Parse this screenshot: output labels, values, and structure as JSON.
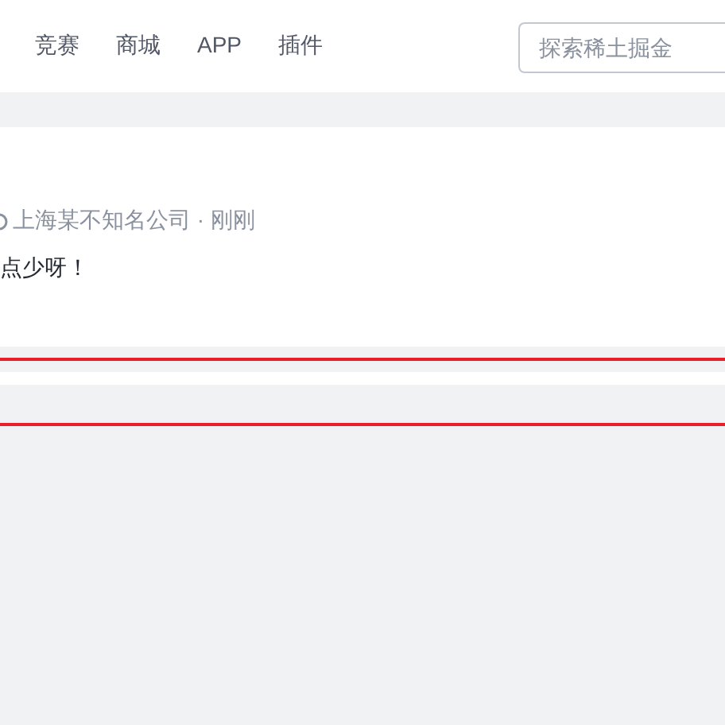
{
  "nav": {
    "items": [
      {
        "label": "竞赛"
      },
      {
        "label": "商城"
      },
      {
        "label": "APP"
      },
      {
        "label": "插件"
      }
    ],
    "search": {
      "placeholder": "探索稀土掘金"
    }
  },
  "comment": {
    "meta": "上海某不知名公司 · 刚刚",
    "text": "点少呀！"
  }
}
